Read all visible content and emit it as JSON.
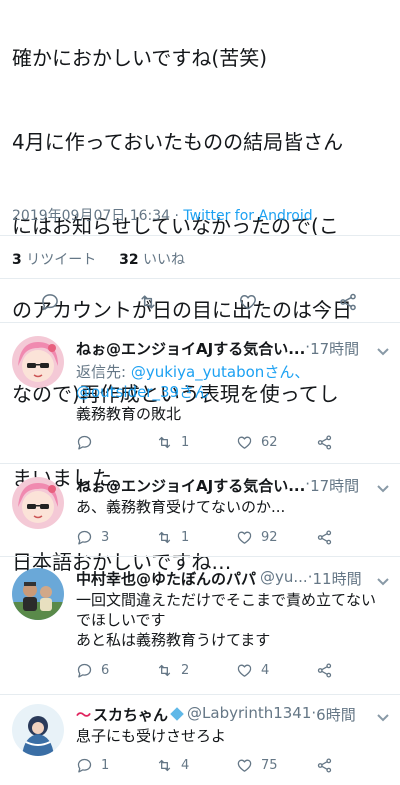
{
  "main_tweet": {
    "lines": [
      "確かにおかしいですね(苦笑)",
      "4月に作っておいたものの結局皆さん",
      "にはお知らせしていなかったので(こ",
      "のアカウントが日の目に出たのは今日",
      "なので)再作成という表現を使ってし",
      "まいました。",
      "日本語おかしいですね…"
    ],
    "timestamp": "2019年09月07日 16:34",
    "separator": "·",
    "via": "Twitter for Android",
    "retweets_count": "3",
    "retweets_label": "リツイート",
    "likes_count": "32",
    "likes_label": "いいね"
  },
  "replies": [
    {
      "name": "ねぉ@エンジョイAJする気合い...",
      "handle": "",
      "time": "17時間",
      "replying_prefix": "返信先:",
      "replying_to": [
        "@yukiya_yutabonさん、",
        "@outsider_39さん"
      ],
      "text_lines": [
        "義務教育の敗北"
      ],
      "reply_count": "",
      "retweet_count": "1",
      "like_count": "62"
    },
    {
      "name": "ねぉ@エンジョイAJする気合い...",
      "handle": "",
      "time": "17時間",
      "text_lines": [
        "あ、義務教育受けてないのか..."
      ],
      "reply_count": "3",
      "retweet_count": "1",
      "like_count": "92"
    },
    {
      "name": "中村幸也@ゆたぼんのパパ",
      "handle": "@yu...",
      "time": "11時間",
      "text_lines": [
        "一回文間違えただけでそこまで責め立てない",
        "でほしいです",
        "あと私は義務教育うけてます"
      ],
      "reply_count": "6",
      "retweet_count": "2",
      "like_count": "4"
    },
    {
      "name": "スカちゃん",
      "handle": "@Labyrinth1341",
      "time": "6時間",
      "text_lines": [
        "息子にも受けさせろよ"
      ],
      "reply_count": "1",
      "retweet_count": "4",
      "like_count": "75"
    }
  ],
  "colors": {
    "text": "#14171a",
    "secondary": "#657786",
    "link": "#1da1f2",
    "divider": "#e6ecf0"
  }
}
